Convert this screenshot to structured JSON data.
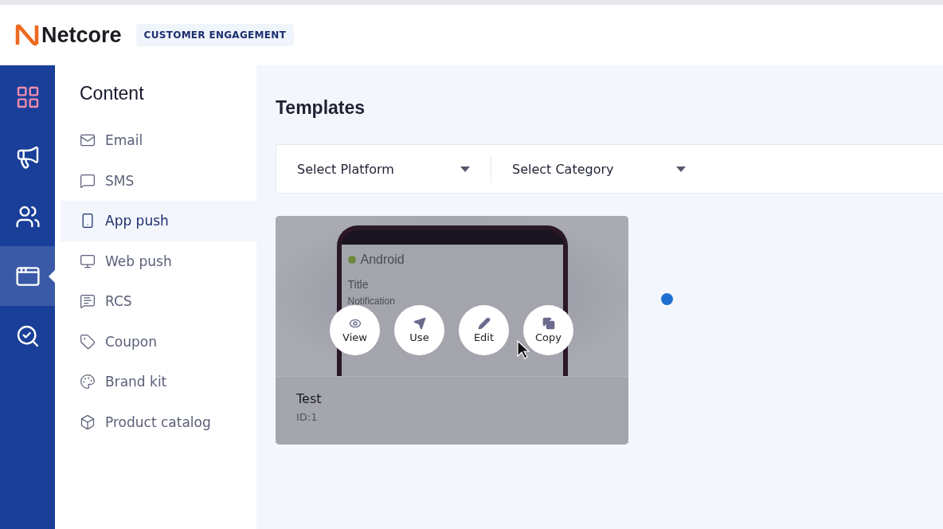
{
  "header": {
    "brand": "Netcore",
    "product": "CUSTOMER ENGAGEMENT"
  },
  "rail": [
    {
      "selected": false
    },
    {
      "selected": false
    },
    {
      "selected": false
    },
    {
      "selected": true
    },
    {
      "selected": false
    }
  ],
  "sidebar": {
    "title": "Content",
    "items": [
      {
        "label": "Email",
        "selected": false
      },
      {
        "label": "SMS",
        "selected": false
      },
      {
        "label": "App push",
        "selected": true
      },
      {
        "label": "Web push",
        "selected": false
      },
      {
        "label": "RCS",
        "selected": false
      },
      {
        "label": "Coupon",
        "selected": false
      },
      {
        "label": "Brand kit",
        "selected": false
      },
      {
        "label": "Product catalog",
        "selected": false
      }
    ]
  },
  "page": {
    "title": "Templates",
    "filters": [
      "Select Platform",
      "Select Category"
    ]
  },
  "template": {
    "preview": {
      "platform": "Android",
      "title": "Title",
      "body": "Notification"
    },
    "actions": [
      "View",
      "Use",
      "Edit",
      "Copy"
    ],
    "name": "Test",
    "id": "ID:1"
  }
}
